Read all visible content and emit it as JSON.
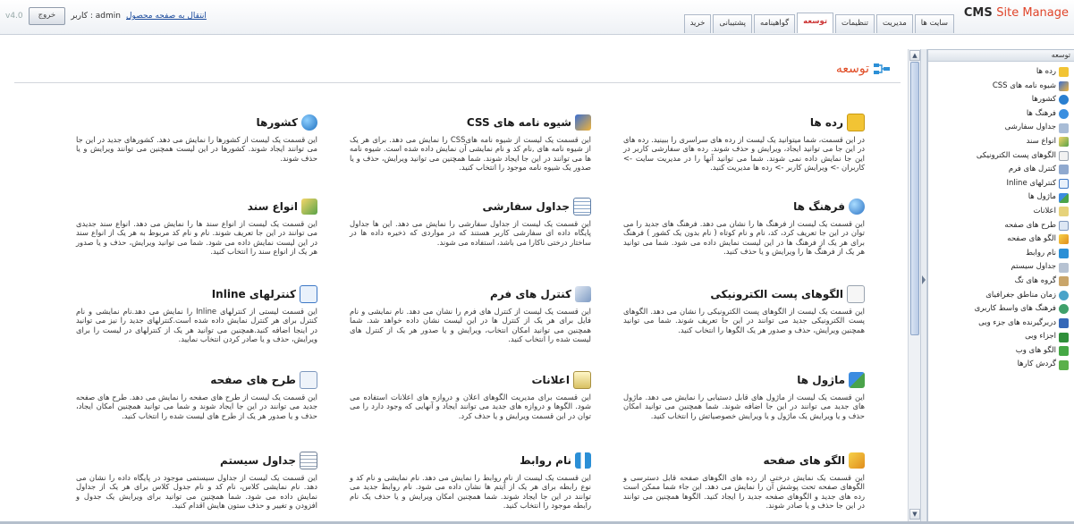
{
  "app": {
    "brand_cms": "CMS",
    "brand_site": "Site Manage",
    "version": "v4.0",
    "logout_label": "خروج",
    "user_label": "کاربر : admin",
    "home_link": "انتقال به صفحه محصول"
  },
  "tabs": [
    {
      "label": "سایت ها",
      "active": false
    },
    {
      "label": "مدیریت",
      "active": false
    },
    {
      "label": "تنظیمات",
      "active": false
    },
    {
      "label": "توسعه",
      "active": true
    },
    {
      "label": "گواهینامه",
      "active": false
    },
    {
      "label": "پشتیبانی",
      "active": false
    },
    {
      "label": "خرید",
      "active": false
    }
  ],
  "sidebar": {
    "title": "توسعه",
    "items": [
      {
        "label": "رده ها",
        "icon": "folder-icon"
      },
      {
        "label": "شیوه نامه های CSS",
        "icon": "brush-icon"
      },
      {
        "label": "کشورها",
        "icon": "globe-icon"
      },
      {
        "label": "فرهنگ ها",
        "icon": "globe-icon"
      },
      {
        "label": "جداول سفارشی",
        "icon": "table-icon"
      },
      {
        "label": "انواع سند",
        "icon": "document-icon"
      },
      {
        "label": "الگوهای پست الکترونیکی",
        "icon": "envelope-icon"
      },
      {
        "label": "کنترل های فرم",
        "icon": "form-control-icon"
      },
      {
        "label": "کنترلهای Inline",
        "icon": "inline-control-icon"
      },
      {
        "label": "ماژول ها",
        "icon": "module-icon"
      },
      {
        "label": "اعلانات",
        "icon": "notification-icon"
      },
      {
        "label": "طرح های صفحه",
        "icon": "layout-icon"
      },
      {
        "label": "الگو های صفحه",
        "icon": "template-icon"
      },
      {
        "label": "نام روابط",
        "icon": "relation-icon"
      },
      {
        "label": "جداول سیستم",
        "icon": "table-icon"
      },
      {
        "label": "گروه های تگ",
        "icon": "tag-icon"
      },
      {
        "label": "زمان مناطق جغرافیای",
        "icon": "clock-icon"
      },
      {
        "label": "فرهنگ های واسط کاربری",
        "icon": "globe-icon"
      },
      {
        "label": "دربرگیرنده های جزء وبی",
        "icon": "webpart-icon"
      },
      {
        "label": "اجزاء وبی",
        "icon": "webpart-icon"
      },
      {
        "label": "الگو های وب",
        "icon": "template-icon"
      },
      {
        "label": "گردش کارها",
        "icon": "workflow-icon"
      }
    ]
  },
  "page": {
    "title": "توسعه",
    "title_icon": "development-icon"
  },
  "cards": [
    {
      "title": "رده ها",
      "icon": "folder-icon",
      "desc": "در این قسمت، شما میتوانید یک لیست از رده های سراسری را ببینید. رده های در این جا می توانید ایجاد، ویرایش و حذف شوند. رده های سفارشی کاربر در این جا نمایش داده نمی شوند. شما می توانید آنها را در مدیریت سایت -> کاربران -> ویرایش کاربر -> رده ها مدیریت کنید."
    },
    {
      "title": "شیوه نامه های CSS",
      "icon": "brush-icon",
      "desc": "این قسمت یک لیست از شیوه نامه هایCSS را نمایش می دهد. برای هر یک از شیوه نامه های ,نام کد و نام نمایشی آن نمایش داده شده است. شیوه نامه ها می توانند در این جا ایجاد شوند. شما همچنین می توانید ویرایش، حذف و یا صدور یک شیوه نامه موجود را انتخاب کنید."
    },
    {
      "title": "کشورها",
      "icon": "globe-icon",
      "desc": "این قسمت یک لیست از کشورها را نمایش می دهد. کشورهای جدید در این جا می توانند ایجاد شوند. کشورها در این لیست همچنین می توانند ویرایش و یا حذف شوند."
    },
    {
      "title": "فرهنگ ها",
      "icon": "globe-icon",
      "desc": "این قسمت یک لیست از فرهنگ ها را نشان می دهد. فرهنگ های جدید را می توان در این جا تعریف کرد، کد، نام و نام کوتاه ( نام بدون یک کشور ) فرهنگ برای هر یک از فرهنگ ها در این لیست نمایش داده می شود. شما می توانید هر یک از فرهنگ ها را ویرایش و یا حذف کنید."
    },
    {
      "title": "جداول سفارشی",
      "icon": "table-icon",
      "desc": "این قسمت یک لیست از جداول سفارشی را نمایش می دهد. این ها جداول پایگاه داده ای سفارشی کاربر هستند که در مواردی که ذخیره داده ها در ساختار درختی ناکارا می باشد، استفاده می شوند."
    },
    {
      "title": "انواع سند",
      "icon": "document-icon",
      "desc": "این قسمت یک لیست از انواع سند ها را نمایش می دهد. انواع سند جدیدی می توانند در این جا تعریف شوند. نام و نام کد مربوط به هر یک از انواع سند در این لیست نمایش داده می شود. شما می توانید ویرایش، حذف و یا صدور هر یک از انواع سند را انتخاب کنید."
    },
    {
      "title": "الگوهای پست الکترونیکی",
      "icon": "envelope-icon",
      "desc": "این قسمت یک لیست از الگوهای پست الکترونیکی را نشان می دهد. الگوهای پست الکترونیکی جدید می توانند در این جا تعریف شوند. شما می توانید همچنین ویرایش، حذف و صدور هر یک الگوها را انتخاب کنید."
    },
    {
      "title": "کنترل های فرم",
      "icon": "form-control-icon",
      "desc": "این قسمت یک لیست از کنترل های فرم را نشان می دهد. نام نمایشی و نام فایل برای هر یک از کنترل ها در این لیست نشان داده خواهد شد. شما همچنین می توانید امکان انتخاب، ویرایش و یا صدور هر یک از کنترل های لیست شده را انتخاب کنید."
    },
    {
      "title": "کنترلهای Inline",
      "icon": "inline-control-icon",
      "desc": "این قسمت لیستی از کنترلهای Inline را نمایش می دهد.نام نمایشی و نام کنترل برای هر کنترل نمایش داده شده است.کنترلهای جدید را نیز می توانید در اینجا اضافه کنید.همچنین می توانید هر یک از کنترلهای در لیست را برای ویرایش، حذف و یا صادر کردن انتخاب نمایید."
    },
    {
      "title": "ماژول ها",
      "icon": "module-icon",
      "desc": "این قسمت یک لیست از ماژول های قابل دستیابی را نمایش می دهد. ماژول های جدید می توانند در این جا اضافه شوند. شما همچنین می توانید امکان حذف و یا ویرایش یک ماژول و یا ویرایش خصوصیاتش را انتخاب کنید."
    },
    {
      "title": "اعلانات",
      "icon": "notification-icon",
      "desc": "این قسمت برای مدیریت الگوهای اعلان و دروازه های اعلانات استفاده می شود. الگوها و دروازه های جدید می توانند ایجاد و آنهایی که وجود دارد را می توان در این قسمت ویرایش و یا حذف کرد."
    },
    {
      "title": "طرح های صفحه",
      "icon": "layout-icon",
      "desc": "این قسمت یک لیست از طرح های صفحه را نمایش می دهد. طرح های صفحه جدید می توانند در این جا ایجاد شوند و شما می توانید همچنین امکان ایجاد، حذف و یا صدور هر یک از طرح های لیست شده را انتخاب کنید."
    },
    {
      "title": "الگو های صفحه",
      "icon": "template-icon",
      "desc": "این قسمت یک نمایش درختی از رده های الگوهای صفحه قابل دسترسی و الگوهای صفحه تحت پوشش آن را نمایش می دهد. این جاء شما ممکن است رده های جدید و الگوهای صفحه جدید را ایجاد کنید. الگوها همچنین می توانند در این جا حذف و یا صادر شوند."
    },
    {
      "title": "نام روابط",
      "icon": "relation-icon",
      "desc": "این قسمت یک لیست از نام روابط را نمایش می دهد. نام نمایشی و نام کد و نوع رابطه برای هر یک از آیتم ها نشان داده می شود. نام روابط جدید می توانند در این جا ایجاد شوند. شما همچنین امکان ویرایش و یا حذف یک نام رابطه موجود را انتخاب کنید."
    },
    {
      "title": "جداول سیستم",
      "icon": "table-icon",
      "desc": "این قسمت یک لیست از جداول سیستمی موجود در پایگاه داده را نشان می دهد. نام نمایشی کلاس، نام کد و نام جدول کلاس برای هر یک از جداول نمایش داده می شود. شما همچنین می توانید برای ویرایش یک جدول و افزودن و تغییر و حذف ستون هایش اقدام کنید."
    }
  ],
  "colors": {
    "brand_red": "#e0452a",
    "header_orange": "#e04b24",
    "active_tab_text": "#cc3333",
    "link_blue": "#1a4a9c"
  }
}
